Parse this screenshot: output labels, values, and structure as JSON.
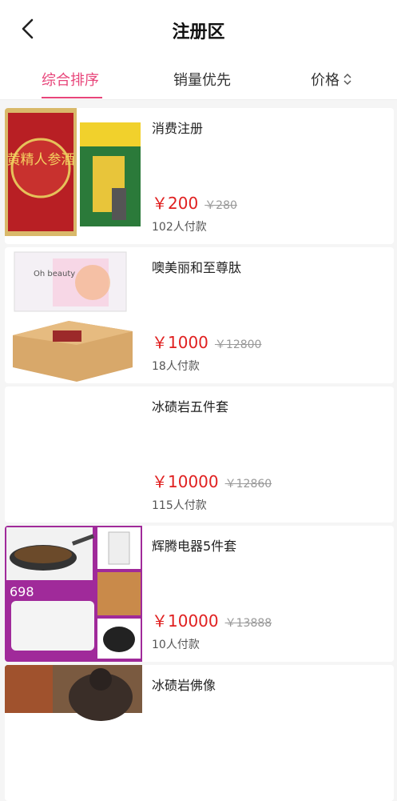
{
  "header": {
    "title": "注册区",
    "back_icon": "chevron-left-icon"
  },
  "tabs": [
    {
      "label": "综合排序",
      "active": true
    },
    {
      "label": "销量优先",
      "active": false
    },
    {
      "label": "价格",
      "active": false,
      "icon": "sort-updown-icon"
    }
  ],
  "colors": {
    "accent": "#e8457a",
    "price": "#e02020"
  },
  "products": [
    {
      "name": "消费注册",
      "price": "￥200",
      "old_price": "￥280",
      "sold": "102人付款",
      "image_text": "黄精人参酒"
    },
    {
      "name": "噢美丽和至尊肽",
      "price": "￥1000",
      "old_price": "￥12800",
      "sold": "18人付款",
      "image_text": "Oh beauty"
    },
    {
      "name": "冰碛岩五件套",
      "price": "￥10000",
      "old_price": "￥12860",
      "sold": "115人付款",
      "image_text": ""
    },
    {
      "name": "辉腾电器5件套",
      "price": "￥10000",
      "old_price": "￥13888",
      "sold": "10人付款",
      "image_text": "698"
    },
    {
      "name": "冰碛岩佛像",
      "price": "",
      "old_price": "",
      "sold": "",
      "image_text": ""
    }
  ]
}
